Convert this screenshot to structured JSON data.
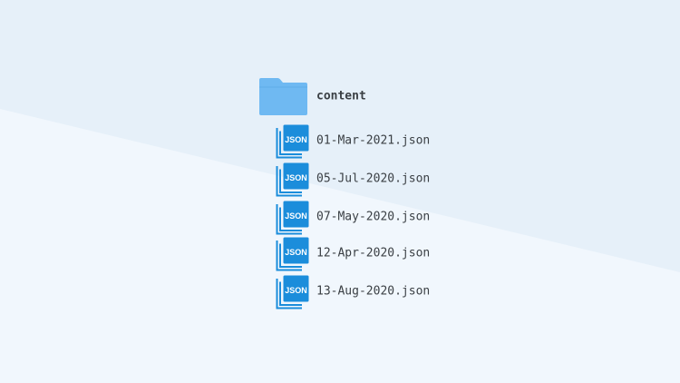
{
  "tree": {
    "folder": {
      "name": "content",
      "icon": "folder-icon",
      "color": "#6fb9f2"
    },
    "files": [
      {
        "name": "01-Mar-2021.json",
        "icon": "json-file-icon",
        "badge": "JSON"
      },
      {
        "name": "05-Jul-2020.json",
        "icon": "json-file-icon",
        "badge": "JSON"
      },
      {
        "name": "07-May-2020.json",
        "icon": "json-file-icon",
        "badge": "JSON"
      },
      {
        "name": "12-Apr-2020.json",
        "icon": "json-file-icon",
        "badge": "JSON"
      },
      {
        "name": "13-Aug-2020.json",
        "icon": "json-file-icon",
        "badge": "JSON"
      }
    ]
  },
  "colors": {
    "background": "#f1f7fd",
    "background_band": "#e6f0f9",
    "json_icon": "#1b8ddb",
    "text": "#3a3f44"
  }
}
